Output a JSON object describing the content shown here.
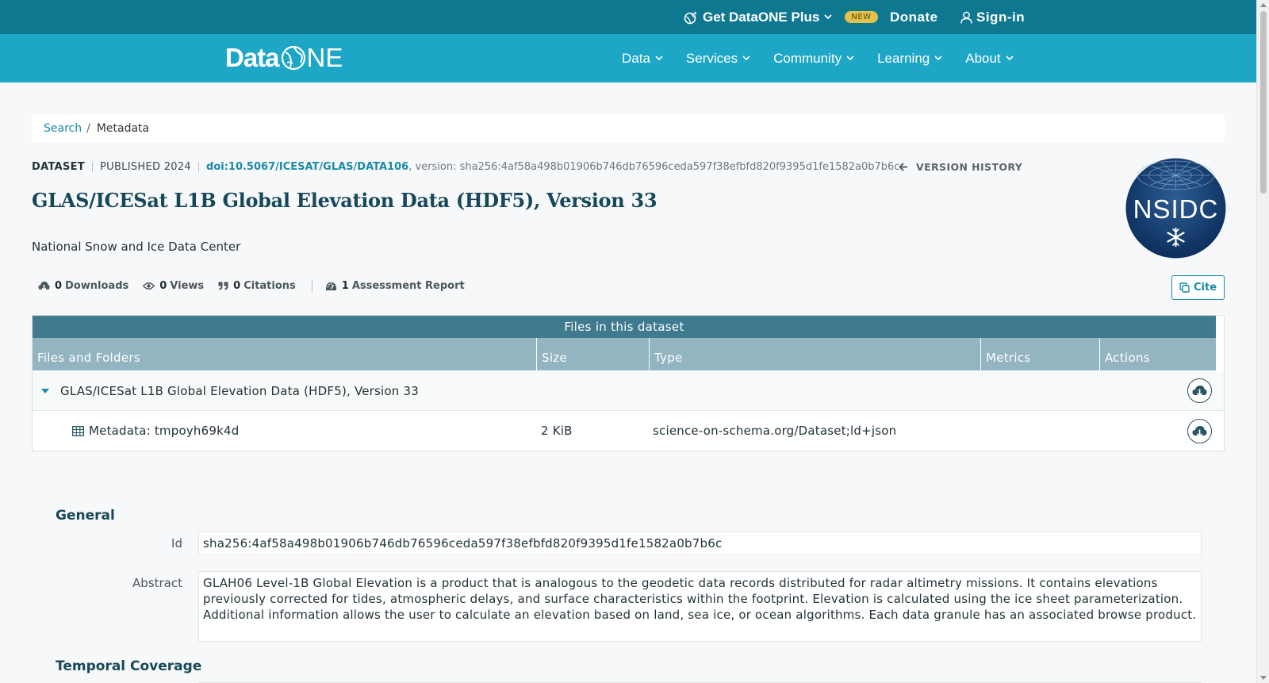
{
  "topbar": {
    "plus_label": "Get DataONE Plus",
    "new_badge": "NEW",
    "donate_label": "Donate",
    "signin_label": "Sign-in"
  },
  "navbar": {
    "logo_text_left": "Data",
    "logo_text_right": "NE",
    "items": [
      {
        "label": "Data"
      },
      {
        "label": "Services"
      },
      {
        "label": "Community"
      },
      {
        "label": "Learning"
      },
      {
        "label": "About"
      }
    ]
  },
  "breadcrumb": {
    "search": "Search",
    "separator": "/",
    "current": "Metadata"
  },
  "dataset": {
    "type": "DATASET",
    "published": "PUBLISHED 2024",
    "doi": "doi:10.5067/ICESAT/GLAS/DATA106",
    "version": ", version: sha256:4af58a498b01906b746db76596ceda597f38efbfd820f9395d1fe1582a0b7b6c",
    "version_history": "VERSION HISTORY",
    "title": "GLAS/ICESat L1B Global Elevation Data (HDF5), Version 33",
    "creator": "National Snow and Ice Data Center",
    "logo_text": "NSIDC"
  },
  "stats": {
    "downloads_num": "0",
    "downloads_label": "Downloads",
    "views_num": "0",
    "views_label": "Views",
    "citations_num": "0",
    "citations_label": "Citations",
    "assessment_num": "1",
    "assessment_label": "Assessment Report",
    "cite_label": "Cite"
  },
  "files": {
    "title": "Files in this dataset",
    "columns": [
      "Files and Folders",
      "Size",
      "Type",
      "Metrics",
      "Actions"
    ],
    "rows": [
      {
        "name": "GLAS/ICESat L1B Global Elevation Data (HDF5), Version 33",
        "size": "",
        "type": ""
      },
      {
        "name": "Metadata: tmpoyh69k4d",
        "size": "2 KiB",
        "type": "science-on-schema.org/Dataset;ld+json"
      }
    ]
  },
  "general": {
    "heading": "General",
    "id_label": "Id",
    "id_value": "sha256:4af58a498b01906b746db76596ceda597f38efbfd820f9395d1fe1582a0b7b6c",
    "abstract_label": "Abstract",
    "abstract_value": "GLAH06 Level-1B Global Elevation is a product that is analogous to the geodetic data records distributed for radar altimetry missions. It contains elevations previously corrected for tides, atmospheric delays, and surface characteristics within the footprint. Elevation is calculated using the ice sheet parameterization. Additional information allows the user to calculate an elevation based on land, sea ice, or ocean algorithms. Each data granule has an associated browse product."
  },
  "temporal": {
    "heading": "Temporal Coverage"
  },
  "colors": {
    "topbar": "#0f7891",
    "navbar": "#1da6c6",
    "accent": "#1a8aa8",
    "title": "#16485a",
    "table_title": "#3f7a8f",
    "table_head": "#93b4c1",
    "badge": "#e3c24b"
  }
}
